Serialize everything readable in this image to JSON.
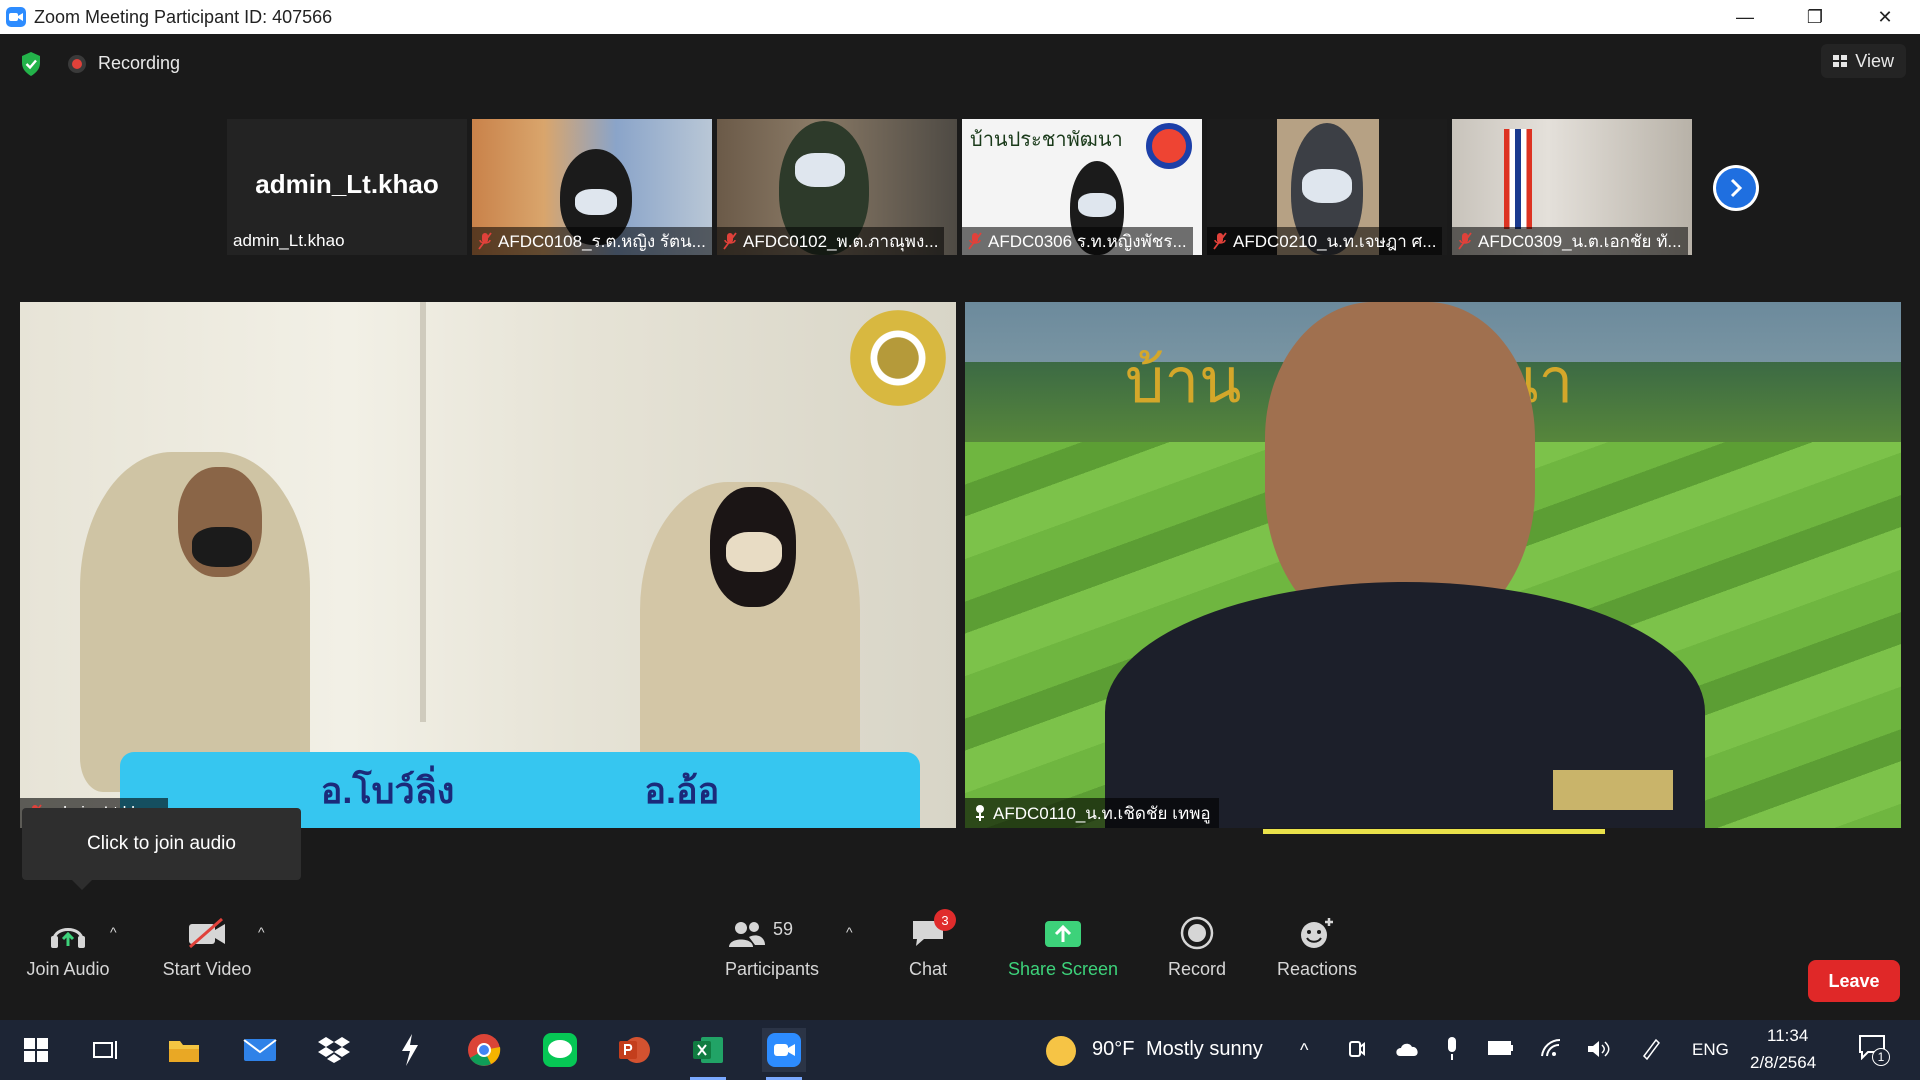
{
  "window": {
    "title": "Zoom Meeting Participant ID: 407566",
    "minimize": "—",
    "restore": "❐",
    "close": "✕"
  },
  "topbar": {
    "recording_label": "Recording",
    "view_label": "View"
  },
  "thumbnails": [
    {
      "name": "admin_Lt.khao",
      "display": "admin_Lt.khao",
      "muted": false
    },
    {
      "name": "AFDC0108_ร.ต.หญิง รัตน...",
      "muted": true
    },
    {
      "name": "AFDC0102_พ.ต.ภาณุพง...",
      "muted": true
    },
    {
      "name": "AFDC0306 ร.ท.หญิงพัชร...",
      "muted": true,
      "banner": "บ้านประชาพัฒนา"
    },
    {
      "name": "AFDC0210_น.ท.เจษฎา ศ...",
      "muted": true
    },
    {
      "name": "AFDC0309_น.ต.เอกชัย ทั...",
      "muted": true
    }
  ],
  "main_videos": {
    "left": {
      "name": "admin_Lt.khao",
      "banner_text": "อ.โบว์ลิ่ง                   อ.อ้อ"
    },
    "right": {
      "name": "AFDC0110_น.ท.เชิดชัย  เทพอู",
      "banner_text": "บ้าน        พัฒนา"
    }
  },
  "tooltip": {
    "text": "Click to join audio"
  },
  "toolbar": {
    "join_audio": "Join Audio",
    "start_video": "Start Video",
    "participants": "Participants",
    "participants_count": "59",
    "chat": "Chat",
    "chat_badge": "3",
    "share_screen": "Share Screen",
    "record": "Record",
    "reactions": "Reactions",
    "leave": "Leave",
    "caret": "^"
  },
  "taskbar": {
    "weather_temp": "90°F",
    "weather_text": "Mostly sunny",
    "language": "ENG",
    "time": "11:34",
    "date": "2/8/2564",
    "notification_count": "1"
  },
  "colors": {
    "accent_blue": "#2d8cff",
    "leave_red": "#e02828",
    "share_green": "#3dd27a",
    "speaker_yellow": "#e9e14a"
  }
}
